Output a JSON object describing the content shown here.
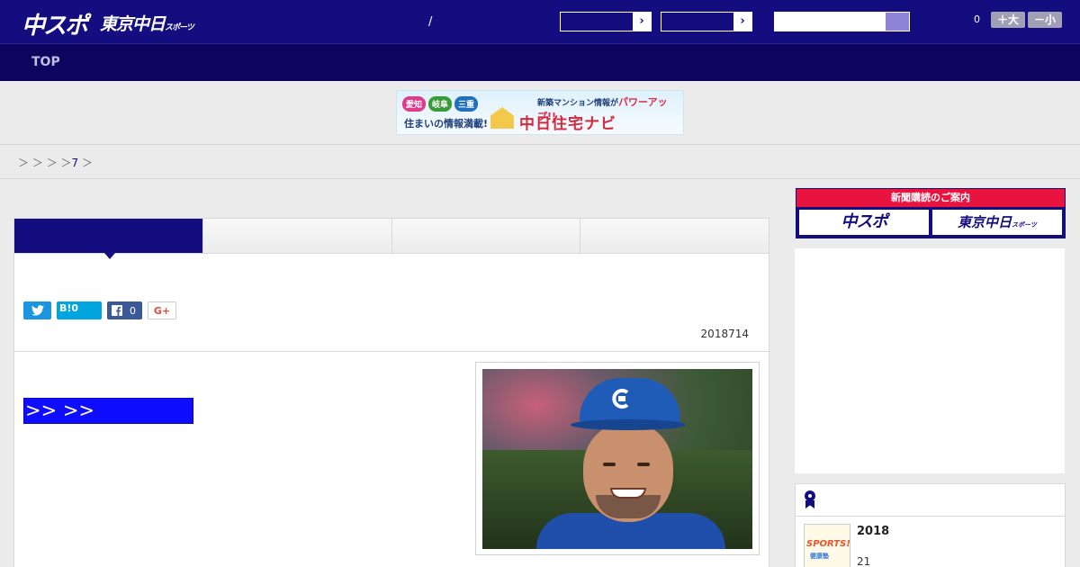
{
  "header": {
    "logo_chuspo": "中スポ",
    "logo_tokyo": "東京中日",
    "logo_tokyo_small": "スポーツ",
    "slash": "/",
    "select1": {
      "value": "",
      "arrow": "›"
    },
    "select2": {
      "value": "",
      "arrow": "›"
    },
    "search": {
      "placeholder": ""
    },
    "count": "0",
    "font_larger": "＋大",
    "font_smaller": "－小"
  },
  "nav": {
    "top": "TOP"
  },
  "banner": {
    "bubbles": [
      "愛知",
      "岐阜",
      "三重"
    ],
    "line1": "住まいの情報満載!",
    "line2_prefix": "新築マンション情報が",
    "line2_highlight": "パワーアップ!!",
    "logo": "中日住宅ナビ"
  },
  "breadcrumb": {
    "sep1": "＞",
    "sep2": "＞",
    "sep3": "＞",
    "sep4": "＞",
    "link": "7",
    "sep5": "＞"
  },
  "article": {
    "tabs": [
      "",
      "",
      "",
      ""
    ],
    "social": {
      "hatena": "B!",
      "hatena_count": "0",
      "facebook_count": "0",
      "googleplus": "G+"
    },
    "date": "2018714",
    "link_box": ">> >>"
  },
  "sidebar": {
    "subscribe_head": "新聞購読のご案内",
    "btn_chuspo": "中スポ",
    "btn_tokyo": "東京中日",
    "btn_tokyo_small": "スポーツ",
    "rank_year": "2018",
    "rank_num": "21",
    "thumb_title": "SPORTS!!",
    "thumb_sub": "健康塾"
  },
  "colors": {
    "header_bg": "#140d7f",
    "nav_bg": "#0b0560",
    "subscribe_red": "#e8133f",
    "link_box_blue": "#0f0dff"
  }
}
